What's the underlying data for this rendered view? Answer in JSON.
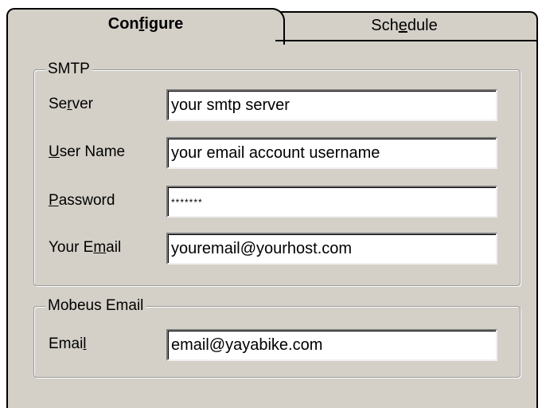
{
  "tabs": {
    "configure": {
      "pre": "Con",
      "accel": "f",
      "post": "igure"
    },
    "schedule": {
      "pre": "Sch",
      "accel": "e",
      "post": "dule"
    }
  },
  "smtp": {
    "title": "SMTP",
    "server": {
      "pre": "Se",
      "accel": "r",
      "post": "ver",
      "value": "your smtp server"
    },
    "username": {
      "pre": "",
      "accel": "U",
      "post": "ser Name",
      "value": "your email account username"
    },
    "password": {
      "pre": "",
      "accel": "P",
      "post": "assword",
      "value": "*******"
    },
    "your_email": {
      "pre": "Your E",
      "accel": "m",
      "post": "ail",
      "value": "youremail@yourhost.com"
    }
  },
  "mobeus": {
    "title": "Mobeus Email",
    "email": {
      "pre": "Emai",
      "accel": "l",
      "post": "",
      "value": "email@yayabike.com"
    }
  }
}
